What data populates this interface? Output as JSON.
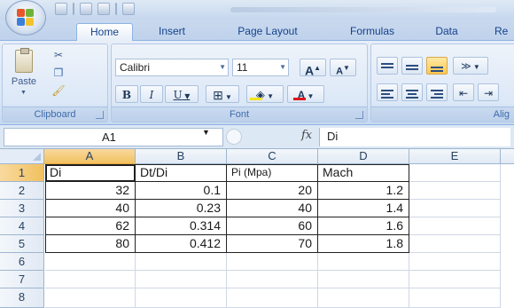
{
  "ribbon": {
    "tabs": [
      {
        "label": "Home",
        "active": true
      },
      {
        "label": "Insert"
      },
      {
        "label": "Page Layout"
      },
      {
        "label": "Formulas"
      },
      {
        "label": "Data"
      },
      {
        "label": "Re"
      }
    ],
    "clipboard": {
      "paste_label": "Paste",
      "group_label": "Clipboard"
    },
    "font": {
      "name": "Calibri",
      "size": "11",
      "grow_label": "A",
      "shrink_label": "A",
      "bold_label": "B",
      "italic_label": "I",
      "underline_label": "U",
      "color_label": "A",
      "group_label": "Font"
    },
    "alignment": {
      "group_label": "Alig"
    }
  },
  "formula_bar": {
    "name_box": "A1",
    "fx_label": "fx",
    "content": "Di"
  },
  "sheet": {
    "columns": [
      "A",
      "B",
      "C",
      "D",
      "E"
    ],
    "rows": [
      "1",
      "2",
      "3",
      "4",
      "5",
      "6",
      "7",
      "8"
    ],
    "headers": [
      "Di",
      "Dt/Di",
      "Pi (Mpa)",
      "Mach"
    ],
    "data": [
      [
        "32",
        "0.1",
        "20",
        "1.2"
      ],
      [
        "40",
        "0.23",
        "40",
        "1.4"
      ],
      [
        "62",
        "0.314",
        "60",
        "1.6"
      ],
      [
        "80",
        "0.412",
        "70",
        "1.8"
      ]
    ],
    "active_cell": "A1"
  },
  "colors": {
    "accent": "#15428b",
    "ribbon_bg": "#dce8f7",
    "selected_header": "#f1c15f",
    "font_color": "#e0141a",
    "highlight": "#f5e41e"
  }
}
